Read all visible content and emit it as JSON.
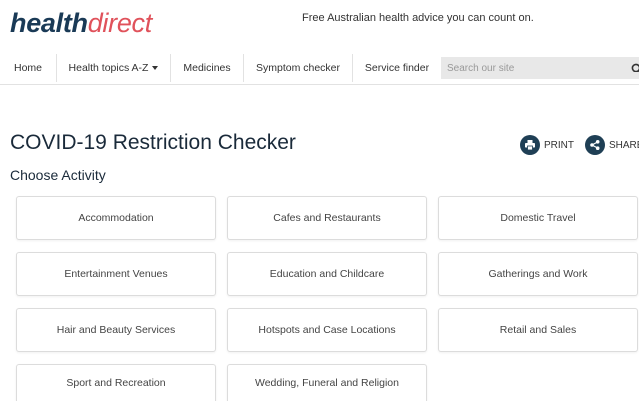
{
  "header": {
    "logo_health": "health",
    "logo_direct": "direct",
    "tagline": "Free Australian health advice you can count on."
  },
  "nav": {
    "home": "Home",
    "health_topics": "Health topics A-Z",
    "medicines": "Medicines",
    "symptom_checker": "Symptom checker",
    "service_finder": "Service finder",
    "search_placeholder": "Search our site"
  },
  "main": {
    "title": "COVID-19 Restriction Checker",
    "subtitle": "Choose Activity",
    "print_label": "PRINT",
    "share_label": "SHARE",
    "activities": [
      "Accommodation",
      "Cafes and Restaurants",
      "Domestic Travel",
      "Entertainment Venues",
      "Education and Childcare",
      "Gatherings and Work",
      "Hair and Beauty Services",
      "Hotspots and Case Locations",
      "Retail and Sales",
      "Sport and Recreation",
      "Wedding, Funeral and Religion"
    ]
  },
  "colors": {
    "brand_navy": "#1a3a56",
    "brand_red": "#e0525b",
    "icon_circle": "#1f3f55",
    "search_bg": "#e8e8e8"
  },
  "icons": {
    "print": "printer-icon",
    "share": "share-icon",
    "search": "search-icon",
    "dropdown": "caret-down-icon"
  }
}
